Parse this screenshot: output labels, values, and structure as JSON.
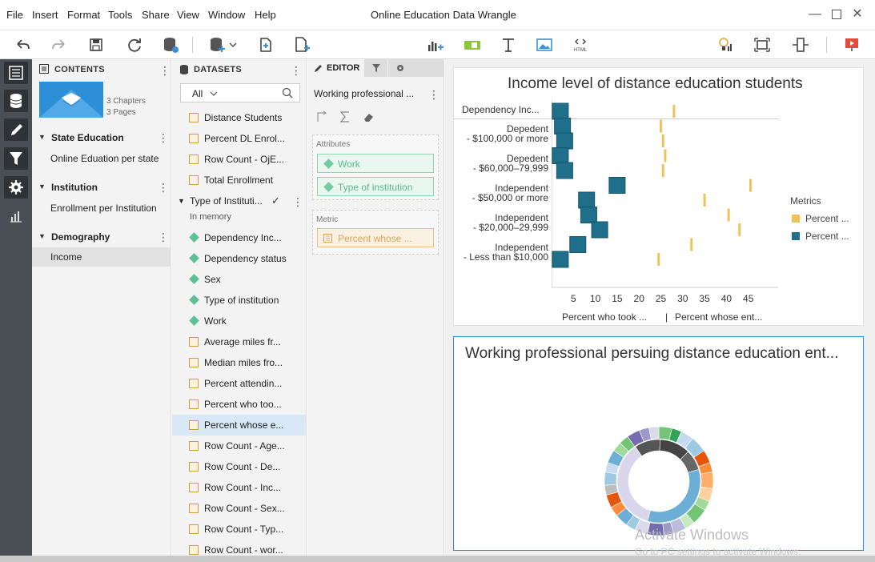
{
  "app": {
    "title": "Online Education Data Wrangle"
  },
  "menu": [
    "File",
    "Insert",
    "Format",
    "Tools",
    "Share",
    "View",
    "Window",
    "Help"
  ],
  "contents": {
    "header": "CONTENTS",
    "summary": {
      "chapters": "3 Chapters",
      "pages": "3 Pages"
    },
    "chapters": [
      {
        "label": "State Education",
        "pages": [
          "Online Eduation per state"
        ]
      },
      {
        "label": "Institution",
        "pages": [
          "Enrollment per Institution"
        ]
      },
      {
        "label": "Demography",
        "pages": [
          "Income"
        ]
      }
    ]
  },
  "datasets": {
    "header": "DATASETS",
    "filter": "All",
    "items_top": [
      "Distance Students",
      "Percent DL Enrol...",
      "Row Count - OjE...",
      "Total Enrollment"
    ],
    "group": {
      "label": "Type of Instituti...",
      "status": "In memory"
    },
    "attributes": [
      "Dependency Inc...",
      "Dependency status",
      "Sex",
      "Type of institution",
      "Work"
    ],
    "metrics": [
      "Average miles fr...",
      "Median miles fro...",
      "Percent attendin...",
      "Percent who too...",
      "Percent whose e...",
      "Row Count - Age...",
      "Row Count - De...",
      "Row Count - Inc...",
      "Row Count - Sex...",
      "Row Count - Typ...",
      "Row Count - wor..."
    ]
  },
  "editor": {
    "tab": "EDITOR",
    "viz_name": "Working professional ...",
    "attributes_label": "Attributes",
    "attributes": [
      "Work",
      "Type of institution"
    ],
    "metric_label": "Metric",
    "metric": "Percent whose ..."
  },
  "chart1": {
    "title": "Income level of distance education students",
    "row_header": "Dependency Inc...",
    "categories": [
      [
        "Depedent",
        "- $100,000 or more"
      ],
      [
        "Depedent",
        "- $60,000–79,999"
      ],
      [
        "Independent",
        "- $50,000 or more"
      ],
      [
        "Independent",
        "- $20,000–29,999"
      ],
      [
        "Independent",
        "- Less than $10,000"
      ]
    ],
    "ticks": [
      "5",
      "10",
      "15",
      "20",
      "25",
      "30",
      "35",
      "40",
      "45"
    ],
    "xlabel_left": "Percent who took ...",
    "xlabel_sep": "|",
    "xlabel_right": "Percent whose ent...",
    "legend_title": "Metrics",
    "legend": [
      {
        "label": "Percent ...",
        "color": "#f2c25a"
      },
      {
        "label": "Percent ...",
        "color": "#1f6f8b"
      }
    ]
  },
  "chart_data": {
    "type": "scatter",
    "title": "Income level of distance education students",
    "xlim": [
      0,
      50
    ],
    "ticks": [
      5,
      10,
      15,
      20,
      25,
      30,
      35,
      40,
      45
    ],
    "series": [
      {
        "name": "Percent ...",
        "color": "#f2c25a",
        "values": [
          28,
          25,
          25.5,
          26,
          25.5,
          45.5,
          35,
          40.5,
          43,
          32,
          24.5
        ]
      },
      {
        "name": "Percent ...",
        "color": "#1f6f8b",
        "values": [
          2,
          2.5,
          3,
          2,
          3,
          15,
          8,
          8.5,
          11,
          6,
          2
        ]
      }
    ]
  },
  "chart2": {
    "title": "Working professional persuing distance education ent..."
  },
  "watermark": {
    "line1": "Activate Windows",
    "line2": "Go to PC settings to activate Windows."
  }
}
